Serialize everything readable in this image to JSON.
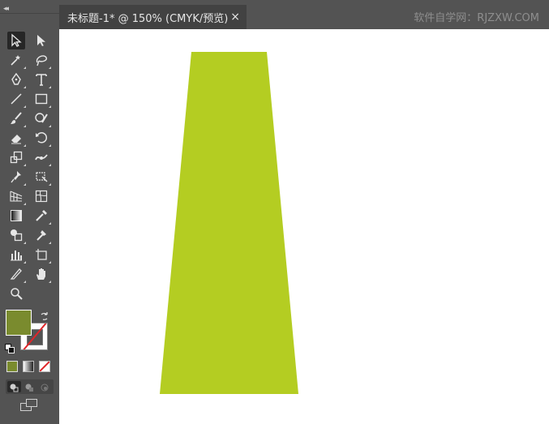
{
  "tab": {
    "title": "未标题-1* @ 150% (CMYK/预览)",
    "close_glyph": "×"
  },
  "watermark": "软件自学网：RJZXW.COM",
  "toolbar": {
    "collapse_glyph": "◂◂",
    "tools": [
      "selection-tool",
      "direct-selection-tool",
      "magic-wand-tool",
      "lasso-tool",
      "pen-tool",
      "type-tool",
      "line-segment-tool",
      "rectangle-tool",
      "paintbrush-tool",
      "shaper-tool",
      "eraser-tool",
      "rotate-tool",
      "scale-tool",
      "width-tool",
      "puppet-warp-tool",
      "free-transform-tool",
      "perspective-grid-tool",
      "mesh-tool",
      "gradient-tool",
      "eyedropper-tool",
      "shape-builder-tool",
      "live-paint-tool",
      "column-graph-tool",
      "artboard-tool",
      "slice-tool",
      "hand-tool",
      "zoom-tool"
    ]
  },
  "colors": {
    "fill": "#7a8b2e",
    "stroke": "none",
    "shape_fill": "#b4cd22"
  },
  "shape": {
    "type": "trapezoid"
  }
}
